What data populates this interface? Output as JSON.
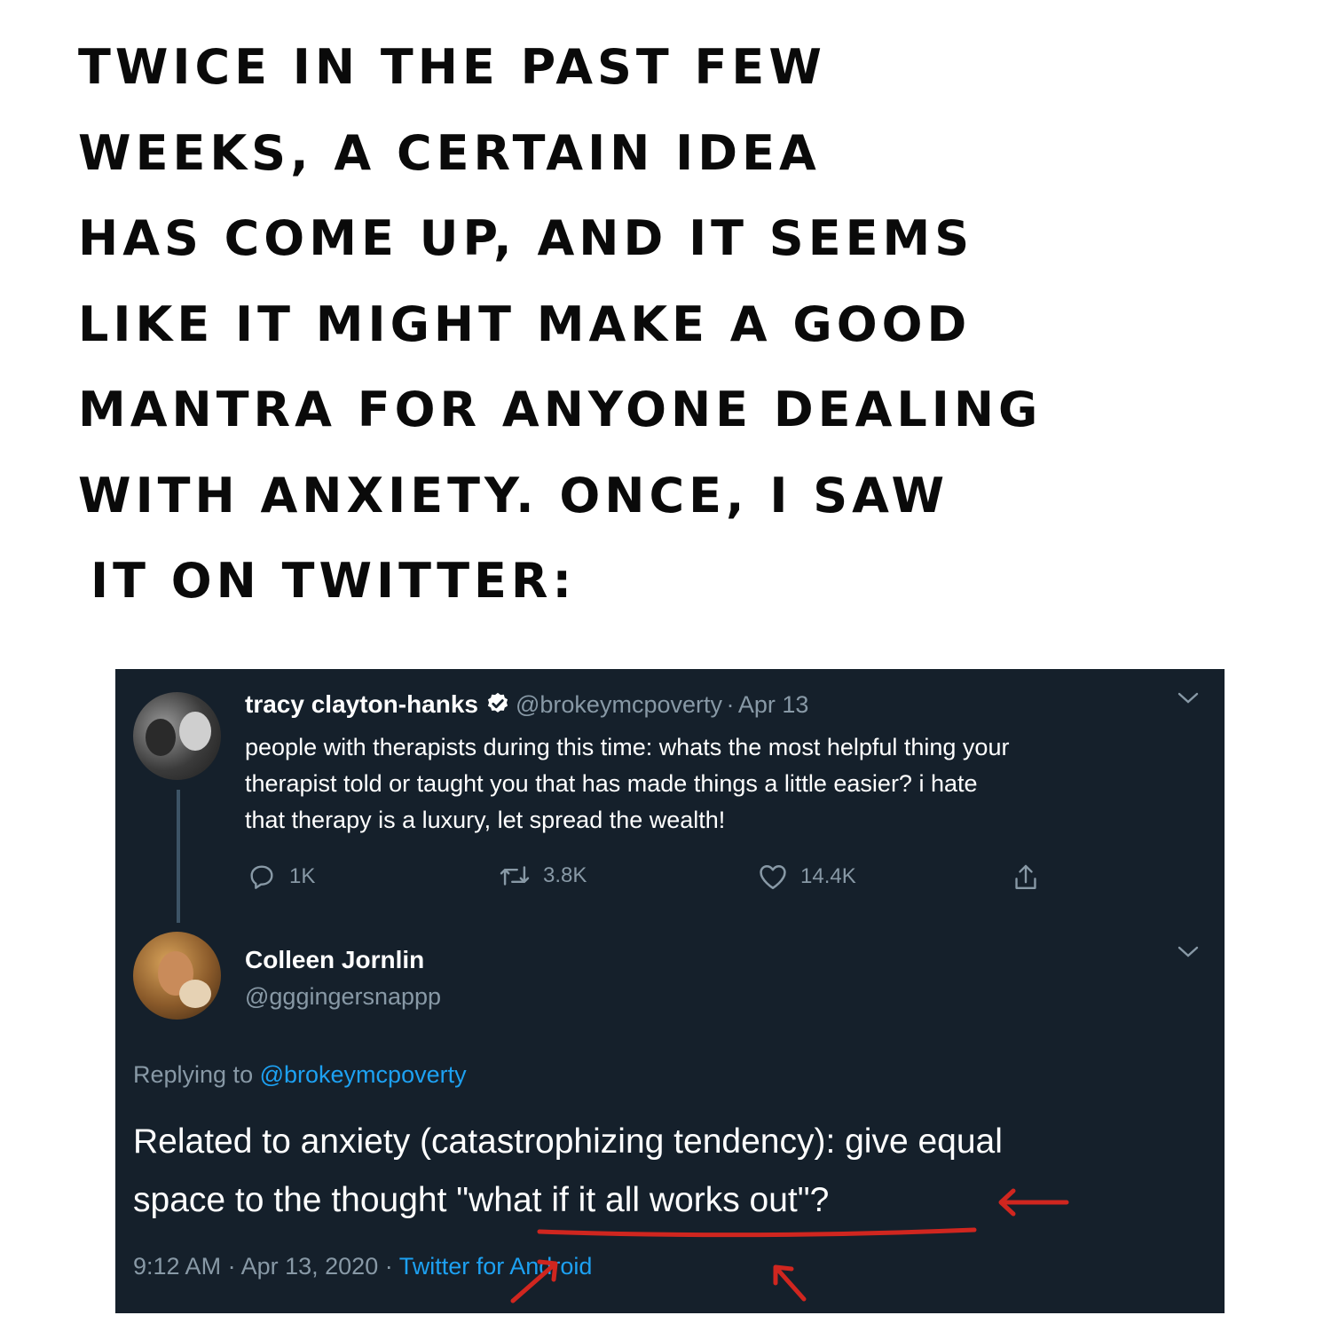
{
  "caption": {
    "lines": [
      "TWICE IN THE PAST FEW",
      "WEEKS, A CERTAIN IDEA",
      "HAS COME UP, AND IT SEEMS",
      "LIKE IT MIGHT MAKE A GOOD",
      "MANTRA FOR ANYONE DEALING",
      "WITH ANXIETY. ONCE, I SAW",
      "IT ON TWITTER:"
    ]
  },
  "tweet1": {
    "display_name": "tracy clayton-hanks",
    "handle": "@brokeymcpoverty",
    "separator": "·",
    "date": "Apr 13",
    "text_lines": [
      "people with therapists during this time: whats the most helpful thing your",
      "therapist told or taught you that has made things a little easier? i hate",
      "that therapy is a luxury, let spread the wealth!"
    ],
    "replies": "1K",
    "retweets": "3.8K",
    "likes": "14.4K",
    "icons": [
      "reply-icon",
      "retweet-icon",
      "like-icon",
      "share-icon",
      "verified-badge-icon",
      "chevron-down-icon"
    ]
  },
  "tweet2": {
    "display_name": "Colleen Jornlin",
    "handle": "@gggingersnappp",
    "replying_prefix": "Replying to",
    "replying_handle": "@brokeymcpoverty",
    "text_line1": "Related to anxiety (catastrophizing tendency): give equal",
    "text_line2_before": "space to the thought ",
    "text_line2_quote": "\"what if it all works out\"?",
    "time": "9:12 AM",
    "date": "Apr 13, 2020",
    "separator": "·",
    "source": "Twitter for Android"
  },
  "colors": {
    "card_bg": "#15202b",
    "muted": "#8899a6",
    "link": "#1da1f2",
    "annotation_red": "#d0261f"
  }
}
